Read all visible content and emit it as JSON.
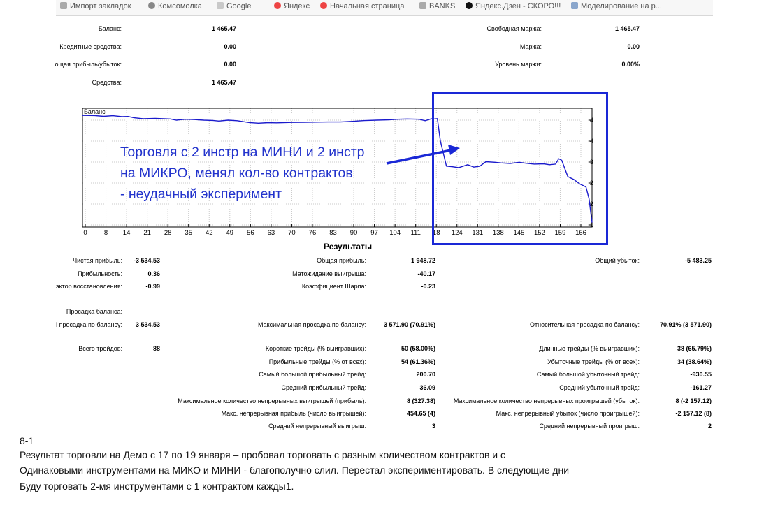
{
  "bookmarks": [
    "Импорт закладок",
    "Комсомолка",
    "Google",
    "Яндекс",
    "Начальная страница",
    "BANKS",
    "Яндекс.Дзен - СКОРО!!!",
    "Моделирование на р..."
  ],
  "account": {
    "balance_label": "Баланс:",
    "balance": "1 465.47",
    "credit_label": "Кредитные средства:",
    "credit": "0.00",
    "floating_label": "ощая прибыль/убыток:",
    "floating": "0.00",
    "equity_label": "Средства:",
    "equity": "1 465.47",
    "free_margin_label": "Свободная маржа:",
    "free_margin": "1 465.47",
    "margin_label": "Маржа:",
    "margin": "0.00",
    "margin_level_label": "Уровень маржи:",
    "margin_level": "0.00%"
  },
  "chart_data": {
    "type": "line",
    "title": "Баланс",
    "x_ticks": [
      "0",
      "8",
      "14",
      "21",
      "28",
      "35",
      "42",
      "49",
      "56",
      "63",
      "70",
      "76",
      "83",
      "90",
      "97",
      "104",
      "111",
      "18",
      "124",
      "131",
      "138",
      "145",
      "152",
      "159",
      "166"
    ],
    "y_ticks": [
      "4956",
      "4223",
      "3489",
      "2756",
      "2026",
      "1289"
    ],
    "ylim": [
      1200,
      5200
    ],
    "grid": true,
    "series": [
      {
        "name": "Баланс",
        "x": [
          0,
          4,
          7,
          10,
          13,
          15,
          17,
          20,
          24,
          29,
          31,
          34,
          37,
          40,
          43,
          45,
          48,
          51,
          55,
          58,
          61,
          64,
          69,
          73,
          77,
          81,
          85,
          89,
          93,
          97,
          101,
          104,
          107,
          111,
          113,
          115,
          116,
          117,
          118,
          120,
          122,
          124,
          127,
          129,
          131,
          133,
          136,
          138,
          141,
          144,
          146,
          149,
          152,
          154,
          156,
          157,
          158,
          160,
          162,
          164,
          166,
          167,
          168
        ],
        "y": [
          4960,
          4955,
          4930,
          4950,
          4920,
          4925,
          4880,
          4850,
          4860,
          4840,
          4800,
          4830,
          4820,
          4800,
          4790,
          4770,
          4800,
          4780,
          4720,
          4700,
          4715,
          4710,
          4725,
          4730,
          4735,
          4740,
          4740,
          4760,
          4785,
          4800,
          4810,
          4830,
          4840,
          4830,
          4780,
          4845,
          4840,
          4850,
          4100,
          3250,
          3230,
          3200,
          3300,
          3220,
          3250,
          3400,
          3380,
          3360,
          3340,
          3380,
          3350,
          3320,
          3330,
          3300,
          3320,
          3500,
          3450,
          2900,
          2800,
          2650,
          2550,
          2150,
          1350
        ]
      }
    ]
  },
  "annotation": {
    "lines": [
      "Торговля с 2 инстр на МИНИ и 2 инстр",
      "на МИКРО, менял кол-во контрактов",
      " - неудачный эксперимент"
    ],
    "color": "#2233cc"
  },
  "results": {
    "title": "Результаты",
    "net_profit_label": "Чистая прибыль:",
    "net_profit": "-3 534.53",
    "gross_profit_label": "Общая прибыль:",
    "gross_profit": "1 948.72",
    "gross_loss_label": "Общий убыток:",
    "gross_loss": "-5 483.25",
    "profit_factor_label": "Прибыльность:",
    "profit_factor": "0.36",
    "expected_payoff_label": "Матожидание выигрыша:",
    "expected_payoff": "-40.17",
    "recovery_factor_label": "эктор восстановления:",
    "recovery_factor": "-0.99",
    "sharpe_label": "Коэффициент Шарпа:",
    "sharpe": "-0.23",
    "drawdown_label": "Просадка баланса:",
    "abs_dd_label": "і просадка по балансу:",
    "abs_dd": "3 534.53",
    "max_dd_label": "Максимальная просадка по балансу:",
    "max_dd": "3 571.90 (70.91%)",
    "rel_dd_label": "Относительная просадка по балансу:",
    "rel_dd": "70.91% (3 571.90)",
    "total_trades_label": "Всего трейдов:",
    "total_trades": "88",
    "short_label": "Короткие трейды (% выигравших):",
    "short": "50 (58.00%)",
    "long_label": "Длинные трейды (% выигравших):",
    "long": "38 (65.79%)",
    "profit_trades_label": "Прибыльные трейды (% от всех):",
    "profit_trades": "54 (61.36%)",
    "loss_trades_label": "Убыточные трейды (% от всех):",
    "loss_trades": "34 (38.64%)",
    "largest_profit_label": "Самый большой прибыльный трейд:",
    "largest_profit": "200.70",
    "largest_loss_label": "Самый большой убыточный трейд:",
    "largest_loss": "-930.55",
    "avg_profit_label": "Средний прибыльный трейд:",
    "avg_profit": "36.09",
    "avg_loss_label": "Средний убыточный трейд:",
    "avg_loss": "-161.27",
    "max_cons_wins_label": "Максимальное количество непрерывных выигрышей (прибыль):",
    "max_cons_wins": "8 (327.38)",
    "max_cons_losses_label": "Максимальное количество непрерывных проигрышей (убыток):",
    "max_cons_losses": "8 (-2 157.12)",
    "max_cons_profit_label": "Макс. непрерывная прибыль (число выигрышей):",
    "max_cons_profit": "454.65 (4)",
    "max_cons_loss_label": "Макс. непрерывный убыток (число проигрышей):",
    "max_cons_loss": "-2 157.12 (8)",
    "avg_cons_wins_label": "Средний непрерывный выигрыш:",
    "avg_cons_wins": "3",
    "avg_cons_losses_label": "Средний непрерывный проигрыш:",
    "avg_cons_losses": "2"
  },
  "notes": {
    "heading": "8-1",
    "line1": "Результат торговли на Демо с 17 по 19 января – пробовал торговать с разным количеством контрактов и с",
    "line2": "Одинаковыми инструментами  на МИКО и МИНИ  - благополучно слил. Перестал экспериментировать.  В следующие дни",
    "line3": "Буду торговать 2-мя инструментами с 1 контрактом кажды1."
  }
}
